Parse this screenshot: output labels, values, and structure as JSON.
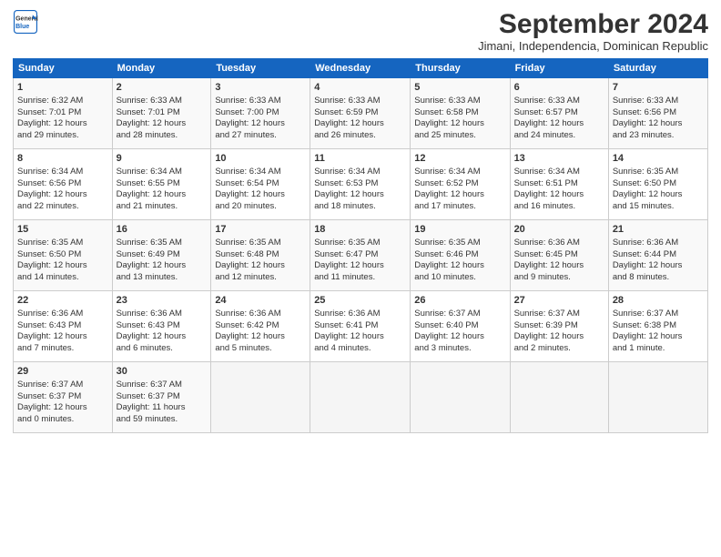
{
  "logo": {
    "line1": "General",
    "line2": "Blue"
  },
  "title": "September 2024",
  "subtitle": "Jimani, Independencia, Dominican Republic",
  "days_of_week": [
    "Sunday",
    "Monday",
    "Tuesday",
    "Wednesday",
    "Thursday",
    "Friday",
    "Saturday"
  ],
  "weeks": [
    [
      {
        "day": "1",
        "lines": [
          "Sunrise: 6:32 AM",
          "Sunset: 7:01 PM",
          "Daylight: 12 hours",
          "and 29 minutes."
        ]
      },
      {
        "day": "2",
        "lines": [
          "Sunrise: 6:33 AM",
          "Sunset: 7:01 PM",
          "Daylight: 12 hours",
          "and 28 minutes."
        ]
      },
      {
        "day": "3",
        "lines": [
          "Sunrise: 6:33 AM",
          "Sunset: 7:00 PM",
          "Daylight: 12 hours",
          "and 27 minutes."
        ]
      },
      {
        "day": "4",
        "lines": [
          "Sunrise: 6:33 AM",
          "Sunset: 6:59 PM",
          "Daylight: 12 hours",
          "and 26 minutes."
        ]
      },
      {
        "day": "5",
        "lines": [
          "Sunrise: 6:33 AM",
          "Sunset: 6:58 PM",
          "Daylight: 12 hours",
          "and 25 minutes."
        ]
      },
      {
        "day": "6",
        "lines": [
          "Sunrise: 6:33 AM",
          "Sunset: 6:57 PM",
          "Daylight: 12 hours",
          "and 24 minutes."
        ]
      },
      {
        "day": "7",
        "lines": [
          "Sunrise: 6:33 AM",
          "Sunset: 6:56 PM",
          "Daylight: 12 hours",
          "and 23 minutes."
        ]
      }
    ],
    [
      {
        "day": "8",
        "lines": [
          "Sunrise: 6:34 AM",
          "Sunset: 6:56 PM",
          "Daylight: 12 hours",
          "and 22 minutes."
        ]
      },
      {
        "day": "9",
        "lines": [
          "Sunrise: 6:34 AM",
          "Sunset: 6:55 PM",
          "Daylight: 12 hours",
          "and 21 minutes."
        ]
      },
      {
        "day": "10",
        "lines": [
          "Sunrise: 6:34 AM",
          "Sunset: 6:54 PM",
          "Daylight: 12 hours",
          "and 20 minutes."
        ]
      },
      {
        "day": "11",
        "lines": [
          "Sunrise: 6:34 AM",
          "Sunset: 6:53 PM",
          "Daylight: 12 hours",
          "and 18 minutes."
        ]
      },
      {
        "day": "12",
        "lines": [
          "Sunrise: 6:34 AM",
          "Sunset: 6:52 PM",
          "Daylight: 12 hours",
          "and 17 minutes."
        ]
      },
      {
        "day": "13",
        "lines": [
          "Sunrise: 6:34 AM",
          "Sunset: 6:51 PM",
          "Daylight: 12 hours",
          "and 16 minutes."
        ]
      },
      {
        "day": "14",
        "lines": [
          "Sunrise: 6:35 AM",
          "Sunset: 6:50 PM",
          "Daylight: 12 hours",
          "and 15 minutes."
        ]
      }
    ],
    [
      {
        "day": "15",
        "lines": [
          "Sunrise: 6:35 AM",
          "Sunset: 6:50 PM",
          "Daylight: 12 hours",
          "and 14 minutes."
        ]
      },
      {
        "day": "16",
        "lines": [
          "Sunrise: 6:35 AM",
          "Sunset: 6:49 PM",
          "Daylight: 12 hours",
          "and 13 minutes."
        ]
      },
      {
        "day": "17",
        "lines": [
          "Sunrise: 6:35 AM",
          "Sunset: 6:48 PM",
          "Daylight: 12 hours",
          "and 12 minutes."
        ]
      },
      {
        "day": "18",
        "lines": [
          "Sunrise: 6:35 AM",
          "Sunset: 6:47 PM",
          "Daylight: 12 hours",
          "and 11 minutes."
        ]
      },
      {
        "day": "19",
        "lines": [
          "Sunrise: 6:35 AM",
          "Sunset: 6:46 PM",
          "Daylight: 12 hours",
          "and 10 minutes."
        ]
      },
      {
        "day": "20",
        "lines": [
          "Sunrise: 6:36 AM",
          "Sunset: 6:45 PM",
          "Daylight: 12 hours",
          "and 9 minutes."
        ]
      },
      {
        "day": "21",
        "lines": [
          "Sunrise: 6:36 AM",
          "Sunset: 6:44 PM",
          "Daylight: 12 hours",
          "and 8 minutes."
        ]
      }
    ],
    [
      {
        "day": "22",
        "lines": [
          "Sunrise: 6:36 AM",
          "Sunset: 6:43 PM",
          "Daylight: 12 hours",
          "and 7 minutes."
        ]
      },
      {
        "day": "23",
        "lines": [
          "Sunrise: 6:36 AM",
          "Sunset: 6:43 PM",
          "Daylight: 12 hours",
          "and 6 minutes."
        ]
      },
      {
        "day": "24",
        "lines": [
          "Sunrise: 6:36 AM",
          "Sunset: 6:42 PM",
          "Daylight: 12 hours",
          "and 5 minutes."
        ]
      },
      {
        "day": "25",
        "lines": [
          "Sunrise: 6:36 AM",
          "Sunset: 6:41 PM",
          "Daylight: 12 hours",
          "and 4 minutes."
        ]
      },
      {
        "day": "26",
        "lines": [
          "Sunrise: 6:37 AM",
          "Sunset: 6:40 PM",
          "Daylight: 12 hours",
          "and 3 minutes."
        ]
      },
      {
        "day": "27",
        "lines": [
          "Sunrise: 6:37 AM",
          "Sunset: 6:39 PM",
          "Daylight: 12 hours",
          "and 2 minutes."
        ]
      },
      {
        "day": "28",
        "lines": [
          "Sunrise: 6:37 AM",
          "Sunset: 6:38 PM",
          "Daylight: 12 hours",
          "and 1 minute."
        ]
      }
    ],
    [
      {
        "day": "29",
        "lines": [
          "Sunrise: 6:37 AM",
          "Sunset: 6:37 PM",
          "Daylight: 12 hours",
          "and 0 minutes."
        ]
      },
      {
        "day": "30",
        "lines": [
          "Sunrise: 6:37 AM",
          "Sunset: 6:37 PM",
          "Daylight: 11 hours",
          "and 59 minutes."
        ]
      },
      null,
      null,
      null,
      null,
      null
    ]
  ]
}
